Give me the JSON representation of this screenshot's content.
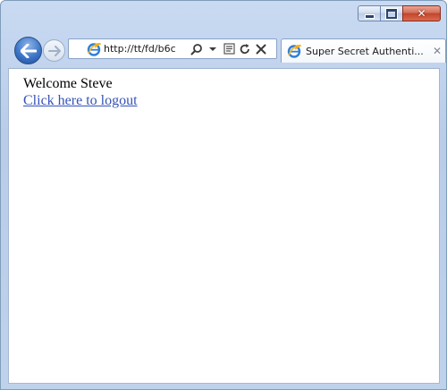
{
  "window": {
    "caption_buttons": {
      "minimize_icon": "minimize-icon",
      "maximize_icon": "maximize-icon",
      "close_icon": "close-icon",
      "close_glyph": "✕"
    }
  },
  "navigation": {
    "back_icon": "back-arrow-icon",
    "forward_icon": "forward-arrow-icon",
    "address": "http://tt/fd/b6c",
    "tools": [
      "search-icon",
      "dropdown-icon",
      "compatibility-view-icon",
      "refresh-icon",
      "stop-icon"
    ]
  },
  "tab": {
    "title": "Super Secret Authenti...",
    "icon": "ie-page-icon",
    "close_glyph": "✕"
  },
  "page": {
    "welcome_text": "Welcome Steve",
    "logout_link": "Click here to logout"
  },
  "colors": {
    "chrome_blue": "#bfd2ec",
    "close_red": "#c2442a",
    "link_blue": "#3552b7"
  }
}
